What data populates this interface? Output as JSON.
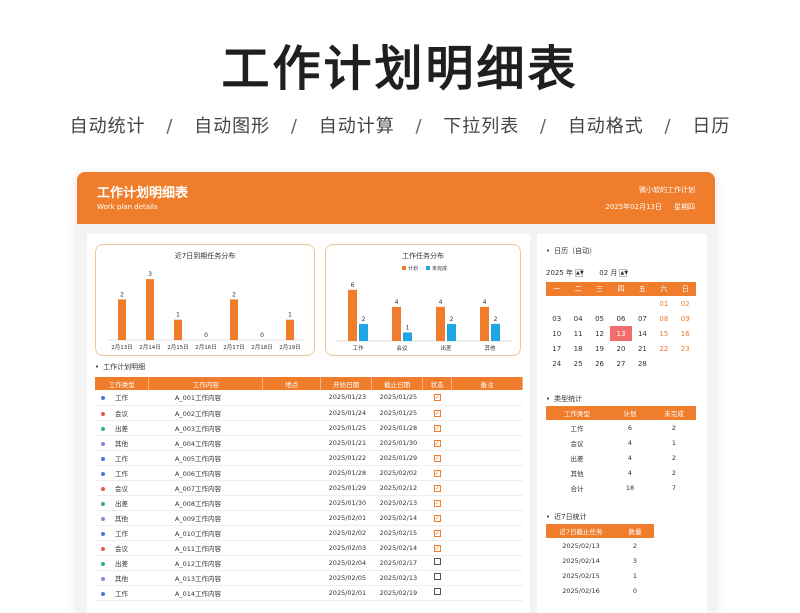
{
  "hero": {
    "title": "工作计划明细表",
    "features": [
      "自动统计",
      "自动图形",
      "自动计算",
      "下拉列表",
      "自动格式",
      "日历"
    ],
    "separator": "/"
  },
  "banner": {
    "title": "工作计划明细表",
    "subtitle": "Work plan details",
    "owner": "微小软的工作计划",
    "date": "2025年02月13日",
    "weekday": "星期四"
  },
  "colors": {
    "accent": "#ef7d2b",
    "plan": "#ef7d2b",
    "unfinished": "#1ea7e4",
    "today": "#f26e6e"
  },
  "chart_data": [
    {
      "type": "bar",
      "title": "近7日到期任务分布",
      "categories": [
        "2月13日",
        "2月14日",
        "2月15日",
        "2月16日",
        "2月17日",
        "2月18日",
        "2月19日"
      ],
      "values": [
        2,
        3,
        1,
        0,
        2,
        0,
        1
      ],
      "ylim": [
        0,
        3.5
      ],
      "xlabel": "",
      "ylabel": ""
    },
    {
      "type": "bar",
      "title": "工作任务分布",
      "categories": [
        "工作",
        "会议",
        "出差",
        "其他"
      ],
      "series": [
        {
          "name": "计划",
          "values": [
            6,
            4,
            4,
            4
          ]
        },
        {
          "name": "未完成",
          "values": [
            2,
            1,
            2,
            2
          ]
        }
      ],
      "ylim": [
        0,
        7.5
      ],
      "legend": "top",
      "xlabel": "",
      "ylabel": ""
    }
  ],
  "detail": {
    "section_title": "工作计划明细",
    "headers": [
      "工作类型",
      "工作内容",
      "地点",
      "开始日期",
      "截止日期",
      "状态",
      "备注"
    ],
    "rows": [
      {
        "color": "#4a7bd9",
        "type": "工作",
        "content": "A_001工作内容",
        "place": "",
        "start": "2025/01/23",
        "end": "2025/01/25",
        "done": true
      },
      {
        "color": "#e8554e",
        "type": "会议",
        "content": "A_002工作内容",
        "place": "",
        "start": "2025/01/24",
        "end": "2025/01/25",
        "done": true
      },
      {
        "color": "#2bb673",
        "type": "出差",
        "content": "A_003工作内容",
        "place": "",
        "start": "2025/01/25",
        "end": "2025/01/28",
        "done": true
      },
      {
        "color": "#9b7fd9",
        "type": "其他",
        "content": "A_004工作内容",
        "place": "",
        "start": "2025/01/21",
        "end": "2025/01/30",
        "done": true
      },
      {
        "color": "#4a7bd9",
        "type": "工作",
        "content": "A_005工作内容",
        "place": "",
        "start": "2025/01/22",
        "end": "2025/01/29",
        "done": true
      },
      {
        "color": "#4a7bd9",
        "type": "工作",
        "content": "A_006工作内容",
        "place": "",
        "start": "2025/01/28",
        "end": "2025/02/02",
        "done": true
      },
      {
        "color": "#e8554e",
        "type": "会议",
        "content": "A_007工作内容",
        "place": "",
        "start": "2025/01/29",
        "end": "2025/02/12",
        "done": true
      },
      {
        "color": "#2bb673",
        "type": "出差",
        "content": "A_008工作内容",
        "place": "",
        "start": "2025/01/30",
        "end": "2025/02/13",
        "done": true
      },
      {
        "color": "#9b7fd9",
        "type": "其他",
        "content": "A_009工作内容",
        "place": "",
        "start": "2025/02/01",
        "end": "2025/02/14",
        "done": true
      },
      {
        "color": "#4a7bd9",
        "type": "工作",
        "content": "A_010工作内容",
        "place": "",
        "start": "2025/02/02",
        "end": "2025/02/15",
        "done": true
      },
      {
        "color": "#e8554e",
        "type": "会议",
        "content": "A_011工作内容",
        "place": "",
        "start": "2025/02/03",
        "end": "2025/02/14",
        "done": true
      },
      {
        "color": "#2bb673",
        "type": "出差",
        "content": "A_012工作内容",
        "place": "",
        "start": "2025/02/04",
        "end": "2025/02/17",
        "done": false
      },
      {
        "color": "#9b7fd9",
        "type": "其他",
        "content": "A_013工作内容",
        "place": "",
        "start": "2025/02/05",
        "end": "2025/02/13",
        "done": false
      },
      {
        "color": "#4a7bd9",
        "type": "工作",
        "content": "A_014工作内容",
        "place": "",
        "start": "2025/02/01",
        "end": "2025/02/19",
        "done": false
      }
    ]
  },
  "calendar": {
    "section_title": "日历（自动）",
    "year": "2025 年",
    "month": "02 月",
    "weekdays": [
      "一",
      "二",
      "三",
      "四",
      "五",
      "六",
      "日"
    ],
    "weeks": [
      [
        "",
        "",
        "",
        "",
        "",
        "01",
        "02"
      ],
      [
        "03",
        "04",
        "05",
        "06",
        "07",
        "08",
        "09"
      ],
      [
        "10",
        "11",
        "12",
        "13",
        "14",
        "15",
        "16"
      ],
      [
        "17",
        "18",
        "19",
        "20",
        "21",
        "22",
        "23"
      ],
      [
        "24",
        "25",
        "26",
        "27",
        "28",
        "",
        ""
      ]
    ],
    "today": "13"
  },
  "type_stats": {
    "section_title": "类型统计",
    "headers": [
      "工作类型",
      "计划",
      "未完成"
    ],
    "rows": [
      [
        "工作",
        "6",
        "2"
      ],
      [
        "会议",
        "4",
        "1"
      ],
      [
        "出差",
        "4",
        "2"
      ],
      [
        "其他",
        "4",
        "2"
      ],
      [
        "合计",
        "18",
        "7"
      ]
    ]
  },
  "week_stats": {
    "section_title": "近7日统计",
    "headers": [
      "近7日截止任务",
      "数量"
    ],
    "rows": [
      [
        "2025/02/13",
        "2"
      ],
      [
        "2025/02/14",
        "3"
      ],
      [
        "2025/02/15",
        "1"
      ],
      [
        "2025/02/16",
        "0"
      ]
    ]
  }
}
